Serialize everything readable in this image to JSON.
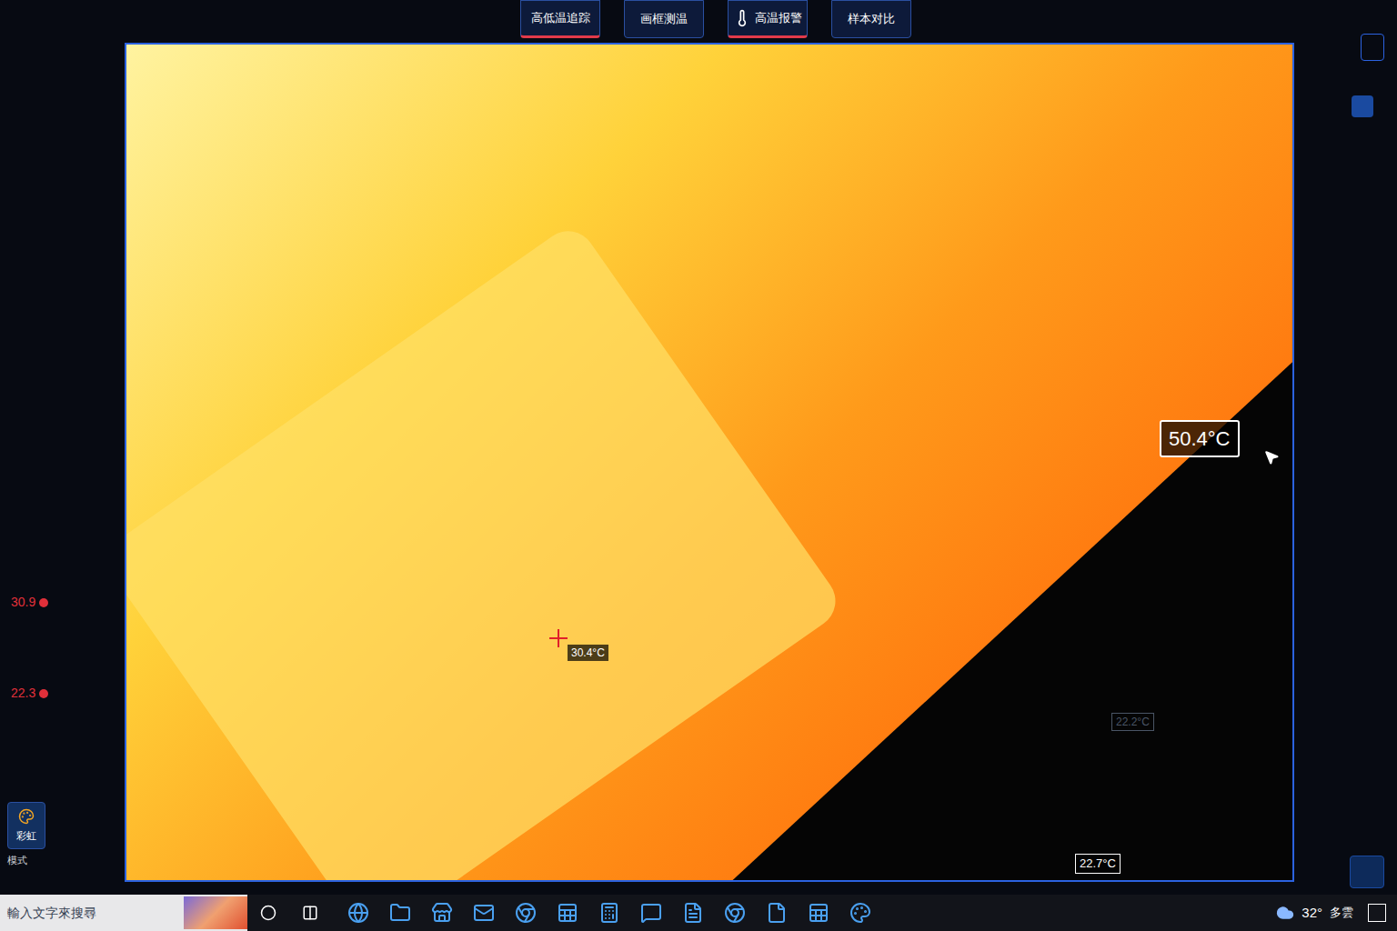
{
  "toolbar": [
    {
      "label": "高低温追踪",
      "selected": true
    },
    {
      "label": "画框测温",
      "selected": false
    },
    {
      "label": "高温报警",
      "selected": true
    },
    {
      "label": "样本对比",
      "selected": false
    }
  ],
  "scale": {
    "max": "30.9",
    "min": "22.3"
  },
  "palette": {
    "label": "彩虹",
    "caption": "模式"
  },
  "readings": [
    {
      "text": "50.4°C",
      "kind": "max"
    },
    {
      "text": "30.4°C",
      "kind": "cursor"
    },
    {
      "text": "22.2°C",
      "kind": "faint"
    },
    {
      "text": "22.7°C",
      "kind": "min"
    }
  ],
  "taskbar": {
    "search": "輸入文字來搜尋",
    "weather_temp": "32°",
    "weather_text": "多雲"
  }
}
